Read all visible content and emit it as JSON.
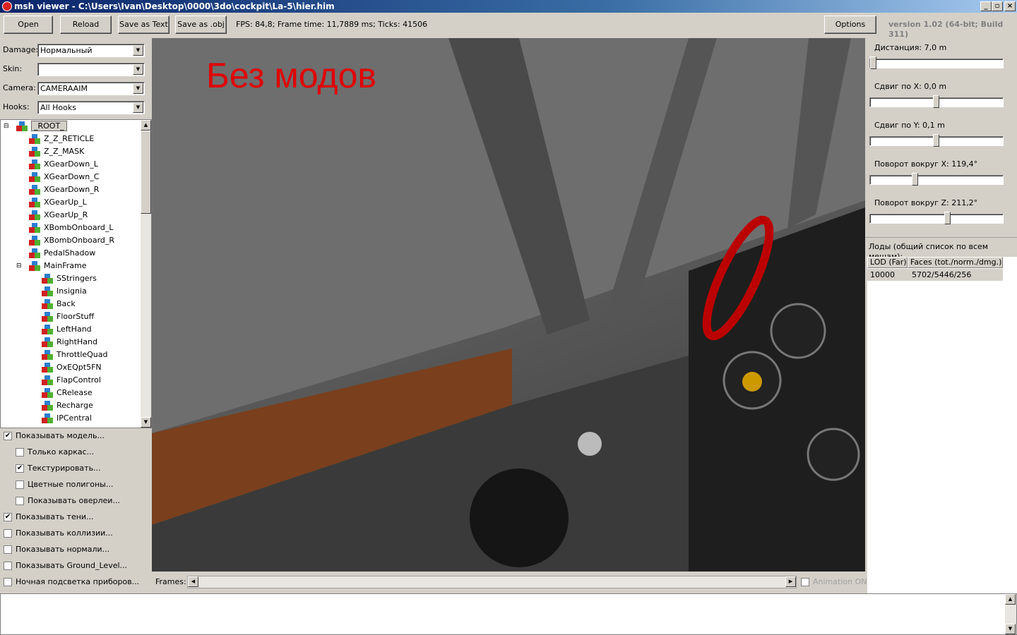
{
  "window": {
    "title": "msh viewer - C:\\Users\\Ivan\\Desktop\\0000\\3do\\cockpit\\La-5\\hier.him",
    "controls": [
      "_",
      "▫",
      "×"
    ]
  },
  "toolbar": {
    "open": "Open",
    "reload": "Reload",
    "save_text": "Save as Text",
    "save_obj": "Save as .obj",
    "stats": "FPS: 84,8; Frame time: 11,7889 ms; Ticks: 41506",
    "options": "Options",
    "version": "version 1.02 (64-bit; Build 311)"
  },
  "combos": [
    {
      "label": "Damage:",
      "value": "Нормальный"
    },
    {
      "label": "Skin:",
      "value": ""
    },
    {
      "label": "Camera:",
      "value": "CAMERAAIM"
    },
    {
      "label": "Hooks:",
      "value": "All Hooks"
    }
  ],
  "tree": {
    "root": "_ROOT_",
    "level1": [
      "Z_Z_RETICLE",
      "Z_Z_MASK",
      "XGearDown_L",
      "XGearDown_C",
      "XGearDown_R",
      "XGearUp_L",
      "XGearUp_R",
      "XBombOnboard_L",
      "XBombOnboard_R",
      "PedalShadow",
      "MainFrame"
    ],
    "level2": [
      "SStringers",
      "Insignia",
      "Back",
      "FloorStuff",
      "LeftHand",
      "RightHand",
      "ThrottleQuad",
      "OxEQpt5FN",
      "FlapControl",
      "CRelease",
      "Recharge",
      "IPCentral"
    ]
  },
  "checkboxes": [
    {
      "label": "Показывать модель...",
      "checked": true,
      "indent": false
    },
    {
      "label": "Только каркас...",
      "checked": false,
      "indent": true
    },
    {
      "label": "Текстурировать...",
      "checked": true,
      "indent": true
    },
    {
      "label": "Цветные полигоны...",
      "checked": false,
      "indent": true
    },
    {
      "label": "Показывать оверлеи...",
      "checked": false,
      "indent": true
    },
    {
      "label": "Показывать тени...",
      "checked": true,
      "indent": false
    },
    {
      "label": "Показывать коллизии...",
      "checked": false,
      "indent": false
    },
    {
      "label": "Показывать нормали...",
      "checked": false,
      "indent": false
    },
    {
      "label": "Показывать Ground_Level...",
      "checked": false,
      "indent": false
    },
    {
      "label": "Ночная подсветка приборов...",
      "checked": false,
      "indent": false
    }
  ],
  "viewport": {
    "overlay_text": "Без модов",
    "overlay_color": "#e00000"
  },
  "frames": {
    "label": "Frames:",
    "animation": "Animation ON",
    "animation_checked": false
  },
  "sliders": [
    {
      "label": "Дистанция:  7,0 m",
      "position": 0.0
    },
    {
      "label": "Сдвиг по X:  0,0 m",
      "position": 0.5
    },
    {
      "label": "Сдвиг по Y:  0,1 m",
      "position": 0.5
    },
    {
      "label": "Поворот вокруг X:  119,4°",
      "position": 0.33
    },
    {
      "label": "Поворот вокруг Z:  211,2°",
      "position": 0.59
    }
  ],
  "lods": {
    "title": "Лоды (общий список по всем мешам):",
    "columns": [
      "LOD (Far)",
      "Faces (tot./norm./dmg.)"
    ],
    "rows": [
      [
        "10000",
        "5702/5446/256"
      ]
    ]
  }
}
